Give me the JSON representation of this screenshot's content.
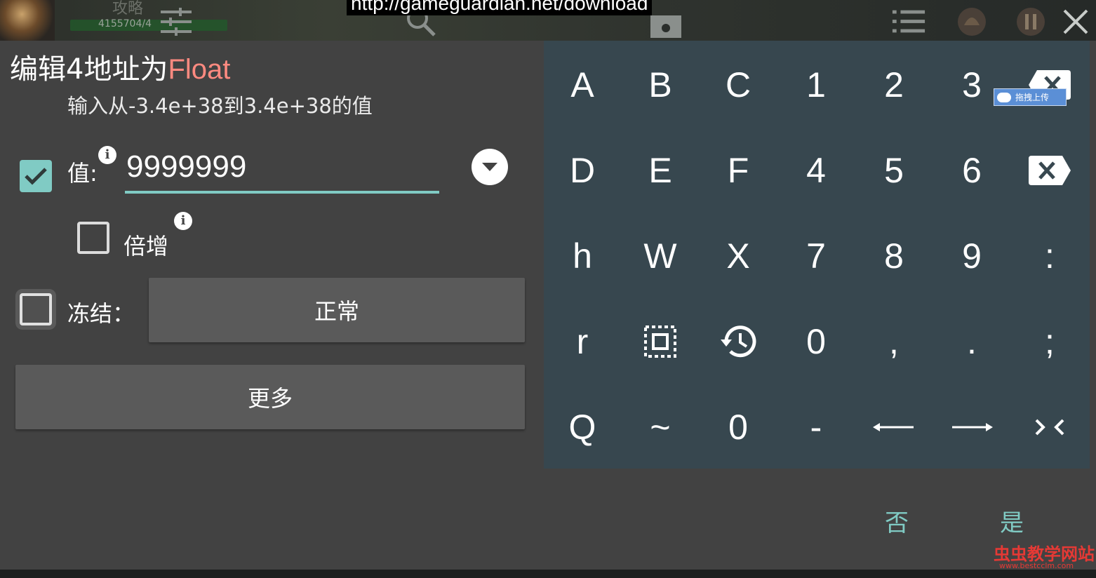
{
  "overlay": {
    "url_banner": "http://gameguardian.net/download",
    "hud_name": "攻略",
    "hud_hp": "4155704/4",
    "icons": [
      "sliders-icon",
      "search-icon",
      "save-icon",
      "list-icon",
      "helmet-icon",
      "pause-icon",
      "close-icon"
    ]
  },
  "dialog": {
    "title_prefix": "编辑4地址为",
    "title_type": "Float",
    "subtitle": "输入从-3.4e+38到3.4e+38的值",
    "value_label": "值:",
    "value": "9999999",
    "value_checked": true,
    "multiply_label": "倍增",
    "multiply_checked": false,
    "freeze_label": "冻结：",
    "freeze_mode": "正常",
    "more_button": "更多",
    "cancel_button": "否",
    "confirm_button": "是",
    "info_glyph": "i"
  },
  "keypad": {
    "rows": [
      [
        "A",
        "B",
        "C",
        "1",
        "2",
        "3",
        "backspace"
      ],
      [
        "D",
        "E",
        "F",
        "4",
        "5",
        "6",
        "backspace"
      ],
      [
        "h",
        "W",
        "X",
        "7",
        "8",
        "9",
        ":"
      ],
      [
        "r",
        "select-all",
        "history",
        "0",
        ",",
        ".",
        ";"
      ],
      [
        "Q",
        "~",
        "0",
        "-",
        "arrow-left",
        "arrow-right",
        "collapse"
      ]
    ]
  },
  "extras": {
    "upload_badge": "拖拽上传",
    "watermark": "虫虫教学网站",
    "watermark_url": "www.bestcclm.com"
  },
  "colors": {
    "accent": "#80cbc4",
    "float_type": "#ff8a80",
    "dialog_bg": "#424242",
    "keypad_bg": "#37474f"
  }
}
